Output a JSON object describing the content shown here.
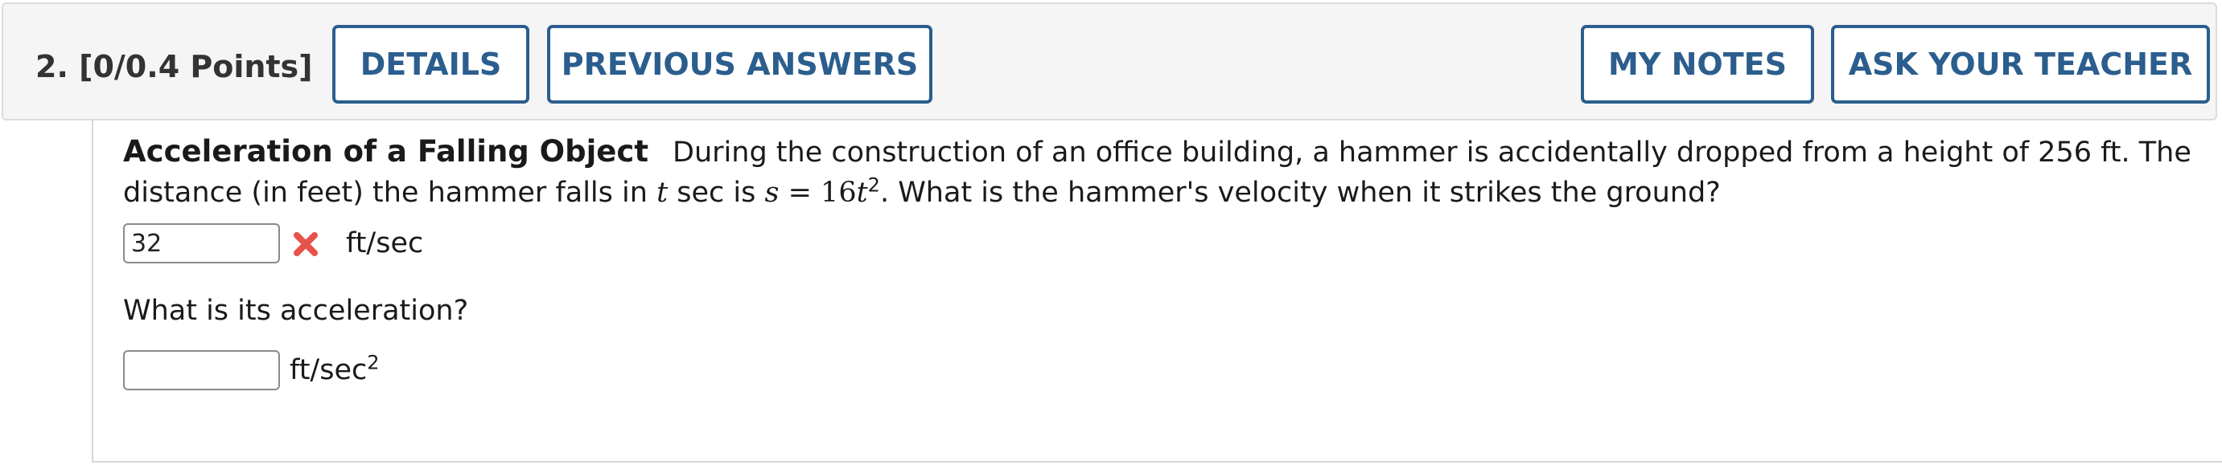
{
  "header": {
    "question_number": "2.",
    "points": "[0/0.4 Points]",
    "details_label": "DETAILS",
    "previous_answers_label": "PREVIOUS ANSWERS",
    "my_notes_label": "MY NOTES",
    "ask_teacher_label": "ASK YOUR TEACHER"
  },
  "problem": {
    "title": "Acceleration of a Falling Object",
    "text_part1": "During the construction of an office building, a hammer is accidentally dropped from a height of 256 ft. The distance (in feet) the hammer falls in ",
    "var_t": "t",
    "text_part2": " sec is ",
    "var_s": "s",
    "equals": " = 16",
    "var_t2": "t",
    "exp": "2",
    "text_part3": ". What is the hammer's velocity when it strikes the ground?"
  },
  "answer1": {
    "value": "32",
    "status": "incorrect",
    "unit": "ft/sec"
  },
  "question2": {
    "text": "What is its acceleration?"
  },
  "answer2": {
    "value": "",
    "unit": "ft/sec",
    "unit_exp": "2"
  },
  "colors": {
    "accent": "#2b5e8e",
    "wrong": "#e5534b",
    "header_bg": "#f5f5f5"
  },
  "icons": {
    "wrong": "x-mark-icon"
  }
}
